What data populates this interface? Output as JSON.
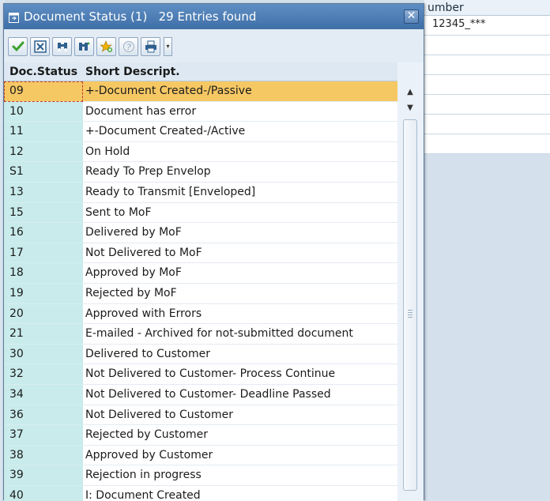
{
  "background": {
    "header_label": "umber",
    "rows": [
      "12345_***",
      "",
      "",
      "",
      "",
      "",
      "",
      ""
    ]
  },
  "dialog": {
    "title": "Document Status (1)   29 Entries found",
    "close_label": "✕"
  },
  "toolbar": {
    "buttons": [
      "check-icon",
      "cancel-icon",
      "binoculars-icon",
      "binoculars-next-icon",
      "favorite-add-icon",
      "info-icon",
      "print-icon"
    ],
    "dropdown_label": "▾"
  },
  "table": {
    "columns": [
      "Doc.Status",
      "Short Descript."
    ],
    "rows": [
      {
        "status": "09",
        "desc": "+-Document Created-/Passive"
      },
      {
        "status": "10",
        "desc": "Document has error"
      },
      {
        "status": "11",
        "desc": "+-Document Created-/Active"
      },
      {
        "status": "12",
        "desc": "On Hold"
      },
      {
        "status": "S1",
        "desc": "Ready To Prep Envelop"
      },
      {
        "status": "13",
        "desc": "Ready to Transmit [Enveloped]"
      },
      {
        "status": "15",
        "desc": "Sent to MoF"
      },
      {
        "status": "16",
        "desc": "Delivered by MoF"
      },
      {
        "status": "17",
        "desc": "Not Delivered to MoF"
      },
      {
        "status": "18",
        "desc": "Approved by MoF"
      },
      {
        "status": "19",
        "desc": "Rejected by MoF"
      },
      {
        "status": "20",
        "desc": "Approved with Errors"
      },
      {
        "status": "21",
        "desc": "E-mailed - Archived for not-submitted document"
      },
      {
        "status": "30",
        "desc": "Delivered to Customer"
      },
      {
        "status": "32",
        "desc": "Not Delivered to Customer- Process Continue"
      },
      {
        "status": "34",
        "desc": "Not Delivered to Customer- Deadline Passed"
      },
      {
        "status": "36",
        "desc": "Not Delivered to Customer"
      },
      {
        "status": "37",
        "desc": "Rejected by Customer"
      },
      {
        "status": "38",
        "desc": "Approved by Customer"
      },
      {
        "status": "39",
        "desc": "Rejection in progress"
      },
      {
        "status": "40",
        "desc": "I: Document Created"
      }
    ],
    "selected_index": 0
  },
  "colors": {
    "selected_row": "#f6c864",
    "status_column": "#c9ebeb",
    "titlebar": "#4f7fb5"
  }
}
